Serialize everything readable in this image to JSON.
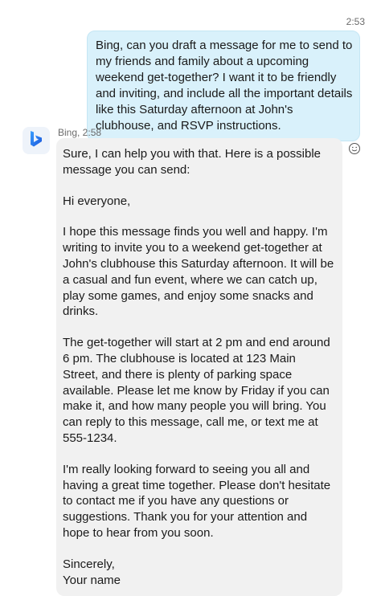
{
  "user_message": {
    "time": "2:53",
    "text": "Bing, can you draft a message for me to send to my friends and family about a upcoming weekend get-together? I want it to be friendly and inviting, and include all the important details like this Saturday afternoon at John's clubhouse, and RSVP instructions."
  },
  "bot_message": {
    "meta": "Bing, 2:58",
    "avatar_icon": "bing-logo-icon",
    "reaction_icon": "smiley-icon",
    "paragraphs": [
      "Sure, I can help you with that. Here is a possible message you can send:",
      "Hi everyone,",
      "I hope this message finds you well and happy. I'm writing to invite you to a weekend get-together at John's clubhouse this Saturday afternoon. It will be a casual and fun event, where we can catch up, play some games, and enjoy some snacks and drinks.",
      "The get-together will start at 2 pm and end around 6 pm. The clubhouse is located at 123 Main Street, and there is plenty of parking space available. Please let me know by Friday if you can make it, and how many people you will bring. You can reply to this message, call me, or text me at 555-1234.",
      "I'm really looking forward to seeing you all and having a great time together. Please don't hesitate to contact me if you have any questions or suggestions. Thank you for your attention and hope to hear from you soon."
    ],
    "signoff": "Sincerely,",
    "signature": "Your name"
  },
  "colors": {
    "user_bubble": "#d9f1fb",
    "bot_bubble": "#f1f1f1",
    "bing_blue": "#1a73e8"
  }
}
